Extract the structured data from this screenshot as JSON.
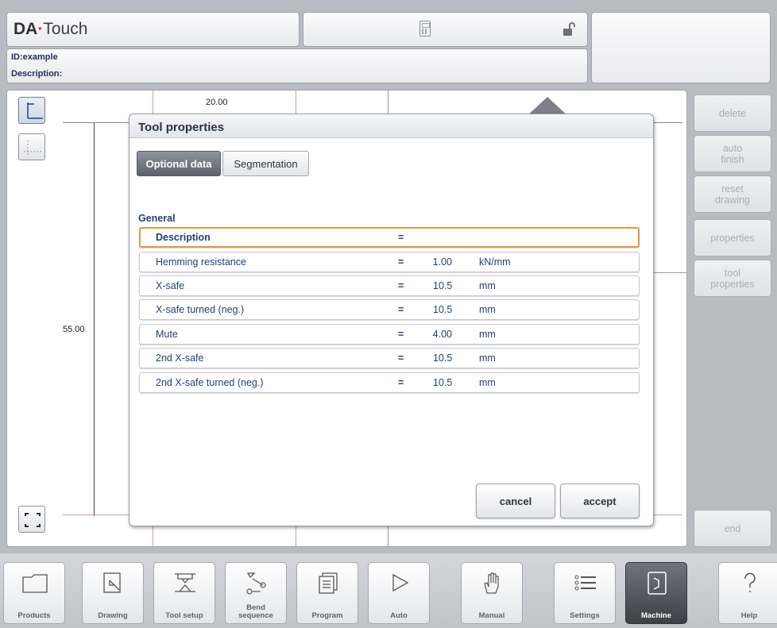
{
  "header": {
    "logo_bold": "DA",
    "logo_dot": "·",
    "logo_rest": "Touch",
    "id_line": "ID:example",
    "description_line": "Description:"
  },
  "drawing": {
    "dim_top": "20.00",
    "dim_left": "55.00"
  },
  "right_panel": {
    "delete": "delete",
    "auto_finish": "auto\nfinish",
    "reset_drawing": "reset\ndrawing",
    "properties": "properties",
    "tool_properties": "tool\nproperties",
    "end": "end"
  },
  "dialog": {
    "title": "Tool properties",
    "tabs": [
      "Optional data",
      "Segmentation"
    ],
    "section": "General",
    "rows": [
      {
        "label": "Description",
        "eq": "=",
        "value": "",
        "unit": ""
      },
      {
        "label": "Hemming resistance",
        "eq": "=",
        "value": "1.00",
        "unit": "kN/mm"
      },
      {
        "label": "X-safe",
        "eq": "=",
        "value": "10.5",
        "unit": "mm"
      },
      {
        "label": "X-safe turned (neg.)",
        "eq": "=",
        "value": "10.5",
        "unit": "mm"
      },
      {
        "label": "Mute",
        "eq": "=",
        "value": "4.00",
        "unit": "mm"
      },
      {
        "label": "2nd X-safe",
        "eq": "=",
        "value": "10.5",
        "unit": "mm"
      },
      {
        "label": "2nd X-safe turned (neg.)",
        "eq": "=",
        "value": "10.5",
        "unit": "mm"
      }
    ],
    "cancel": "cancel",
    "accept": "accept"
  },
  "nav": {
    "items": [
      "Products",
      "Drawing",
      "Tool setup",
      "Bend\nsequence",
      "Program",
      "Auto",
      "Manual",
      "Settings",
      "Machine",
      "Help"
    ],
    "active": "Machine"
  },
  "colors": {
    "accent_text": "#243e7a",
    "selection_border": "#e49a3a",
    "active_tab": "#5b626b"
  }
}
